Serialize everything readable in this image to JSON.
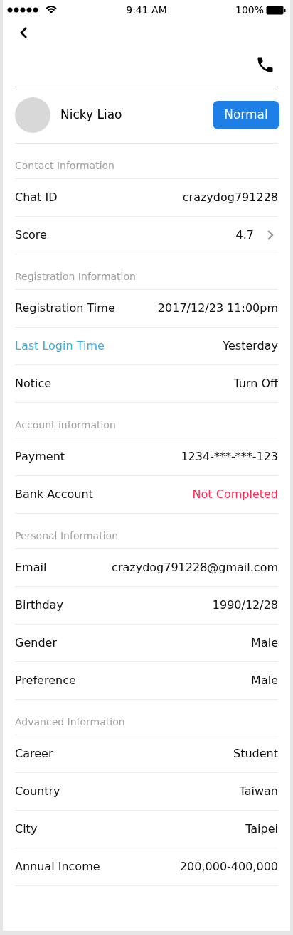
{
  "status_bar": {
    "time": "9:41 AM",
    "battery": "100%"
  },
  "profile": {
    "name": "Nicky Liao",
    "status_button": "Normal"
  },
  "sections": [
    {
      "title": "Contact Information",
      "rows": [
        {
          "label": "Chat ID",
          "value": "crazydog791228"
        },
        {
          "label": "Score",
          "value": "4.7",
          "link": true
        }
      ]
    },
    {
      "title": "Registration Information",
      "rows": [
        {
          "label": "Registration Time",
          "value": "2017/12/23 11:00pm"
        },
        {
          "label": "Last Login Time",
          "value": "Yesterday",
          "kind": "linked",
          "color": "#35aee6"
        },
        {
          "label": "Notice",
          "value": "Turn Off"
        }
      ]
    },
    {
      "title": "Account information",
      "rows": [
        {
          "label": "Payment",
          "value": "1234-***-***-123"
        },
        {
          "label": "Bank Account",
          "value": "Not Completed",
          "kind": "warning",
          "color": "#ff2d55"
        }
      ]
    },
    {
      "title": "Personal Information",
      "rows": [
        {
          "label": "Email",
          "value": "crazydog791228@gmail.com"
        },
        {
          "label": "Birthday",
          "value": "1990/12/28"
        },
        {
          "label": "Gender",
          "value": "Male"
        },
        {
          "label": "Preference",
          "value": "Male"
        }
      ]
    },
    {
      "title": "Advanced Information",
      "rows": [
        {
          "label": "Career",
          "value": "Student"
        },
        {
          "label": "Country",
          "value": "Taiwan"
        },
        {
          "label": "City",
          "value": "Taipei"
        },
        {
          "label": "Annual Income",
          "value": "200,000-400,000"
        }
      ]
    }
  ]
}
